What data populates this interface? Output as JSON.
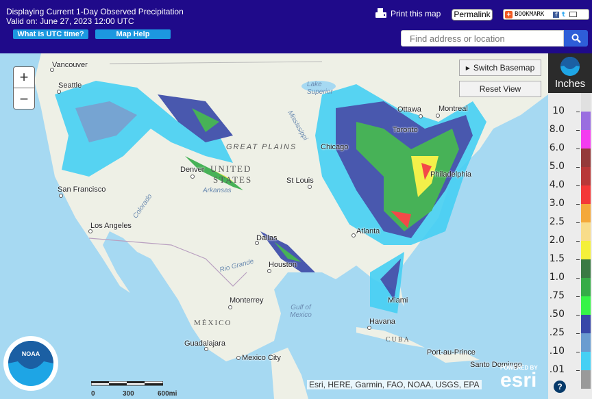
{
  "header": {
    "title_line1": "Displaying Current 1-Day Observed Precipitation",
    "title_line2": "Valid on: June 27, 2023 12:00 UTC",
    "utc_button": "What is UTC time?",
    "help_button": "Map Help",
    "print_label": "Print this map",
    "permalink_label": "Permalink",
    "bookmark_label": "BOOKMARK",
    "search_placeholder": "Find address or location"
  },
  "map": {
    "zoom_in": "+",
    "zoom_out": "−",
    "switch_basemap": "Switch Basemap",
    "reset_view": "Reset View",
    "scale_labels": [
      "0",
      "300",
      "600mi"
    ],
    "attribution": "Esri, HERE, Garmin, FAO, NOAA, USGS, EPA",
    "esri_powered": "POWERED BY",
    "esri_logo": "esri",
    "cities": [
      {
        "name": "Vancouver"
      },
      {
        "name": "Seattle"
      },
      {
        "name": "San Francisco"
      },
      {
        "name": "Los Angeles"
      },
      {
        "name": "Denver"
      },
      {
        "name": "St Louis"
      },
      {
        "name": "Chicago"
      },
      {
        "name": "Dallas"
      },
      {
        "name": "Houston"
      },
      {
        "name": "Atlanta"
      },
      {
        "name": "Miami"
      },
      {
        "name": "Havana"
      },
      {
        "name": "Monterrey"
      },
      {
        "name": "Guadalajara"
      },
      {
        "name": "Mexico City"
      },
      {
        "name": "Ottawa"
      },
      {
        "name": "Montreal"
      },
      {
        "name": "Toronto"
      },
      {
        "name": "Philadelphia"
      },
      {
        "name": "Port-au-Prince"
      },
      {
        "name": "Santo Domingo"
      }
    ],
    "regions": {
      "great_plains": "GREAT PLAINS",
      "united": "UNITED",
      "states": "STATES",
      "mexico": "MÉXICO",
      "cuba": "CUBA"
    },
    "water": {
      "lake_superior": "Lake Superior",
      "gulf": "Gulf of Mexico",
      "arkansas": "Arkansas",
      "rio_grande": "Rio Grande",
      "colorado": "Colorado",
      "mississippi": "Mississippi"
    }
  },
  "legend": {
    "unit": "Inches",
    "help": "?",
    "bins": [
      {
        "label": "10",
        "color": "#e0e0e0"
      },
      {
        "label": "8.0",
        "color": "#9a6ee0"
      },
      {
        "label": "6.0",
        "color": "#f43cf0"
      },
      {
        "label": "5.0",
        "color": "#943a3a"
      },
      {
        "label": "4.0",
        "color": "#b83838"
      },
      {
        "label": "3.0",
        "color": "#f43838"
      },
      {
        "label": "2.5",
        "color": "#f4a83a"
      },
      {
        "label": "2.0",
        "color": "#f8dc8a"
      },
      {
        "label": "1.5",
        "color": "#f4f03a"
      },
      {
        "label": "1.0",
        "color": "#3a7a44"
      },
      {
        "label": ".75",
        "color": "#36ac48"
      },
      {
        "label": ".50",
        "color": "#36f448"
      },
      {
        "label": ".25",
        "color": "#3848a8"
      },
      {
        "label": ".10",
        "color": "#6a9cd0"
      },
      {
        "label": ".01",
        "color": "#46d0f4"
      },
      {
        "label": "",
        "color": "#9a9a9a"
      }
    ]
  }
}
